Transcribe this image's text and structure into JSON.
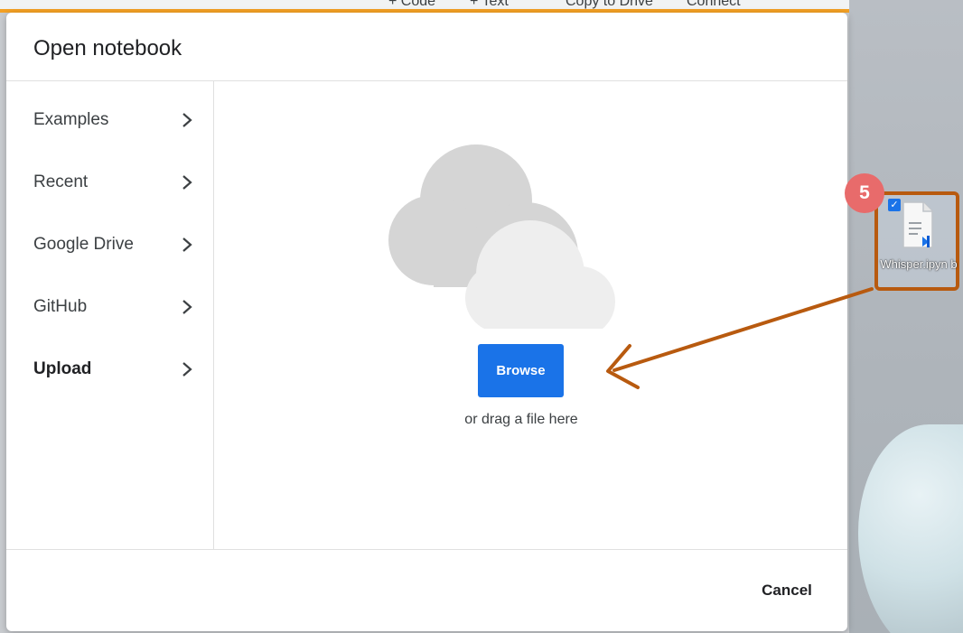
{
  "toolbar": {
    "items": [
      "+ Code",
      "+ Text",
      "Copy to Drive",
      "Connect"
    ]
  },
  "dialog": {
    "title": "Open notebook",
    "nav": [
      {
        "label": "Examples",
        "active": false
      },
      {
        "label": "Recent",
        "active": false
      },
      {
        "label": "Google Drive",
        "active": false
      },
      {
        "label": "GitHub",
        "active": false
      },
      {
        "label": "Upload",
        "active": true
      }
    ],
    "upload": {
      "icon": "cloud-icon",
      "browse_label": "Browse",
      "drag_text": "or drag a file here"
    },
    "cancel_label": "Cancel"
  },
  "desktop": {
    "file_name": "Whisper.ipyn b",
    "file_icon": "vscode-notebook-file-icon",
    "step_number": "5"
  },
  "colors": {
    "accent": "#1a73e8",
    "annotation": "#b85a0f",
    "badge": "#e86b6b",
    "topbar_accent": "#f3a024"
  }
}
